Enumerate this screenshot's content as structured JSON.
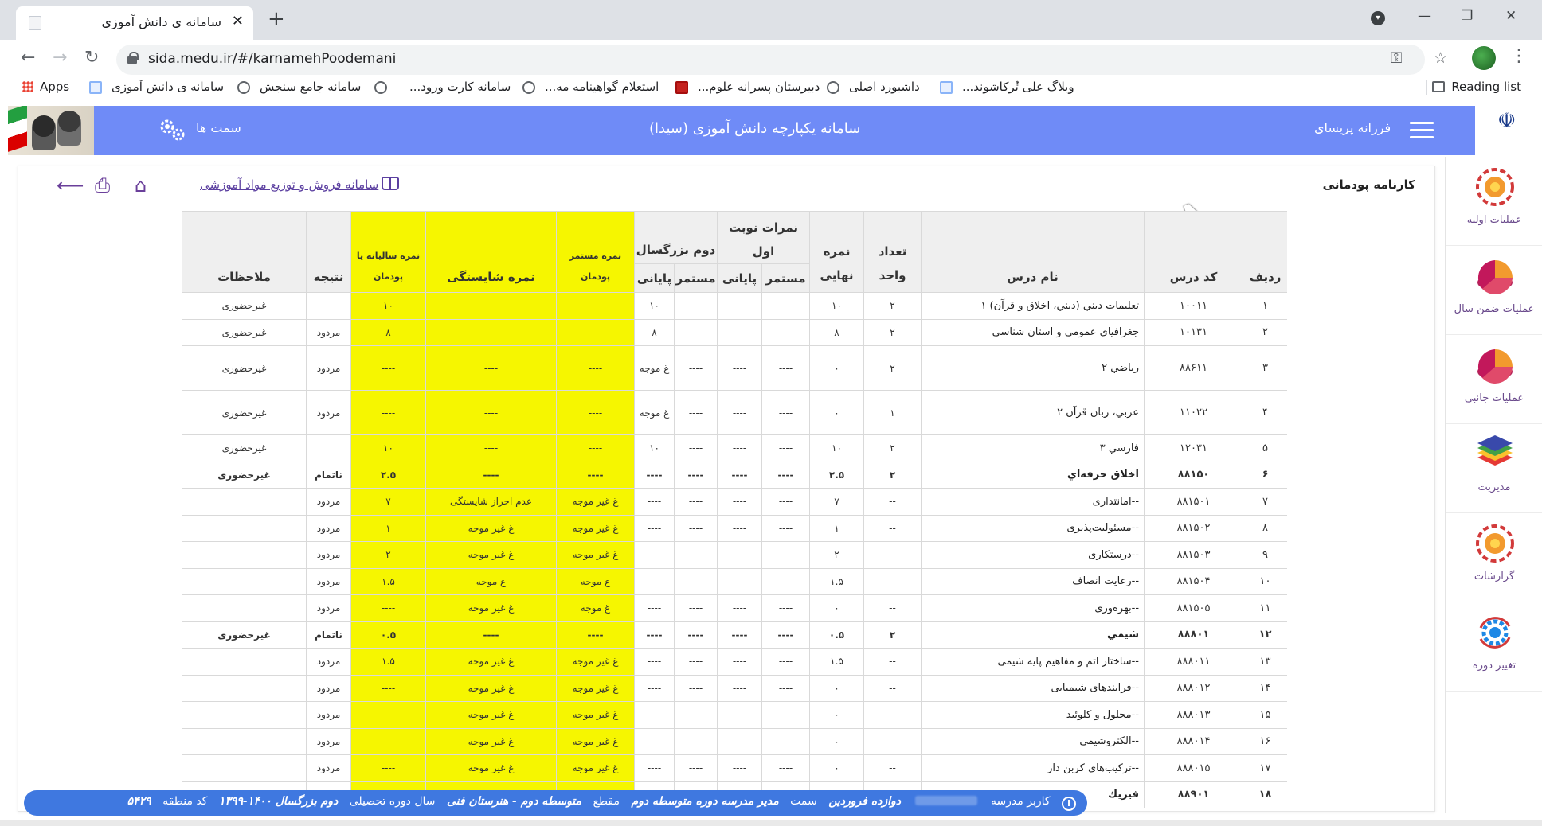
{
  "browser": {
    "tab_title": "سامانه ی دانش آموزی",
    "url": "sida.medu.ir/#/karnamehPoodemani",
    "bookmarks": [
      "Apps",
      "سامانه ی دانش آموزی",
      "سامانه جامع سنجش",
      "سامانه کارت ورود...",
      "استعلام گواهینامه مه...",
      "دبیرستان پسرانه علوم...",
      "داشبورد اصلی",
      "وبلاگ علی تُرکاشوند..."
    ],
    "reading_list": "Reading list"
  },
  "header": {
    "role_label": "سمت ها",
    "title": "سامانه یکپارچه دانش آموزی  (سیدا)",
    "user": "فرزانه پریسای"
  },
  "sidebar": {
    "items": [
      {
        "label": "عملیات اولیه",
        "icon": "gear-sun-icon"
      },
      {
        "label": "عملیات ضمن سال",
        "icon": "pie-chart-icon"
      },
      {
        "label": "عملیات جانبی",
        "icon": "pie-chart-icon"
      },
      {
        "label": "مدیریت",
        "icon": "layers-icon"
      },
      {
        "label": "گزارشات",
        "icon": "gear-sun-icon"
      },
      {
        "label": "تغییر دوره",
        "icon": "gear-cycle-icon"
      }
    ]
  },
  "page": {
    "title": "کارنامه پودمانی",
    "shop_link": "سامانه فروش و توزیع مواد آموزشی"
  },
  "table": {
    "headers": {
      "row": "ردیف",
      "code": "کد درس",
      "name": "نام درس",
      "units": "تعداد واحد",
      "final_grade": "نمره نهایی",
      "first_turn": "نمرات نوبت اول",
      "second_turn": "دوم بزرگسال",
      "continuous": "مستمر",
      "final": "پایانی",
      "mod_continuous": "نمره مستمر پودمان",
      "competency": "نمره شایستگی",
      "yearly": "نمره سالیانه یا پودمان",
      "result": "نتیجه",
      "notes": "ملاحظات"
    },
    "rows": [
      {
        "row": "۱",
        "code": "۱۰۰۱۱",
        "name": "تعليمات ديني (ديني، اخلاق و قرآن) ۱",
        "units": "۲",
        "final": "۱۰",
        "t1c": "----",
        "t1f": "----",
        "t2c": "----",
        "t2f": "۱۰",
        "mc": "----",
        "comp": "----",
        "yearly": "۱۰",
        "result": "",
        "notes": "غیرحضوری",
        "bold": false,
        "tall": false
      },
      {
        "row": "۲",
        "code": "۱۰۱۳۱",
        "name": "جغرافياي عمومي و استان شناسي",
        "units": "۲",
        "final": "۸",
        "t1c": "----",
        "t1f": "----",
        "t2c": "----",
        "t2f": "۸",
        "mc": "----",
        "comp": "----",
        "yearly": "۸",
        "result": "مردود",
        "notes": "غیرحضوری",
        "bold": false,
        "tall": false
      },
      {
        "row": "۳",
        "code": "۸۸۶۱۱",
        "name": "رياضي ۲",
        "units": "۲",
        "final": "۰",
        "t1c": "----",
        "t1f": "----",
        "t2c": "----",
        "t2f": "غ موجه",
        "mc": "----",
        "comp": "----",
        "yearly": "----",
        "result": "مردود",
        "notes": "غیرحضوری",
        "bold": false,
        "tall": true
      },
      {
        "row": "۴",
        "code": "۱۱۰۲۲",
        "name": "عربي، زبان قرآن ۲",
        "units": "۱",
        "final": "۰",
        "t1c": "----",
        "t1f": "----",
        "t2c": "----",
        "t2f": "غ موجه",
        "mc": "----",
        "comp": "----",
        "yearly": "----",
        "result": "مردود",
        "notes": "غیرحضوری",
        "bold": false,
        "tall": true
      },
      {
        "row": "۵",
        "code": "۱۲۰۳۱",
        "name": "فارسي ۳",
        "units": "۲",
        "final": "۱۰",
        "t1c": "----",
        "t1f": "----",
        "t2c": "----",
        "t2f": "۱۰",
        "mc": "----",
        "comp": "----",
        "yearly": "۱۰",
        "result": "",
        "notes": "غیرحضوری",
        "bold": false,
        "tall": false
      },
      {
        "row": "۶",
        "code": "۸۸۱۵۰",
        "name": "اخلاق حرفه‌اي",
        "units": "۲",
        "final": "۲.۵",
        "t1c": "----",
        "t1f": "----",
        "t2c": "----",
        "t2f": "----",
        "mc": "----",
        "comp": "----",
        "yearly": "۲.۵",
        "result": "ناتمام",
        "notes": "غیرحضوری",
        "bold": true,
        "tall": false
      },
      {
        "row": "۷",
        "code": "۸۸۱۵۰۱",
        "name": "--امانتداری",
        "units": "--",
        "final": "۷",
        "t1c": "----",
        "t1f": "----",
        "t2c": "----",
        "t2f": "----",
        "mc": "غ غیر موجه",
        "comp": "عدم احراز شایستگی",
        "yearly": "۷",
        "result": "مردود",
        "notes": "",
        "bold": false,
        "tall": false
      },
      {
        "row": "۸",
        "code": "۸۸۱۵۰۲",
        "name": "--مسئولیت‌پذیری",
        "units": "--",
        "final": "۱",
        "t1c": "----",
        "t1f": "----",
        "t2c": "----",
        "t2f": "----",
        "mc": "غ غیر موجه",
        "comp": "غ غیر موجه",
        "yearly": "۱",
        "result": "مردود",
        "notes": "",
        "bold": false,
        "tall": false
      },
      {
        "row": "۹",
        "code": "۸۸۱۵۰۳",
        "name": "--درستکاری",
        "units": "--",
        "final": "۲",
        "t1c": "----",
        "t1f": "----",
        "t2c": "----",
        "t2f": "----",
        "mc": "غ غیر موجه",
        "comp": "غ غیر موجه",
        "yearly": "۲",
        "result": "مردود",
        "notes": "",
        "bold": false,
        "tall": false
      },
      {
        "row": "۱۰",
        "code": "۸۸۱۵۰۴",
        "name": "--رعایت انصاف",
        "units": "--",
        "final": "۱.۵",
        "t1c": "----",
        "t1f": "----",
        "t2c": "----",
        "t2f": "----",
        "mc": "غ موجه",
        "comp": "غ موجه",
        "yearly": "۱.۵",
        "result": "مردود",
        "notes": "",
        "bold": false,
        "tall": false
      },
      {
        "row": "۱۱",
        "code": "۸۸۱۵۰۵",
        "name": "--بهره‌وری",
        "units": "--",
        "final": "۰",
        "t1c": "----",
        "t1f": "----",
        "t2c": "----",
        "t2f": "----",
        "mc": "غ موجه",
        "comp": "غ غیر موجه",
        "yearly": "----",
        "result": "مردود",
        "notes": "",
        "bold": false,
        "tall": false
      },
      {
        "row": "۱۲",
        "code": "۸۸۸۰۱",
        "name": "شيمي",
        "units": "۲",
        "final": "۰.۵",
        "t1c": "----",
        "t1f": "----",
        "t2c": "----",
        "t2f": "----",
        "mc": "----",
        "comp": "----",
        "yearly": "۰.۵",
        "result": "ناتمام",
        "notes": "غیرحضوری",
        "bold": true,
        "tall": false
      },
      {
        "row": "۱۳",
        "code": "۸۸۸۰۱۱",
        "name": "--ساختار اتم و مفاهیم پایه شیمی",
        "units": "--",
        "final": "۱.۵",
        "t1c": "----",
        "t1f": "----",
        "t2c": "----",
        "t2f": "----",
        "mc": "غ غیر موجه",
        "comp": "غ غیر موجه",
        "yearly": "۱.۵",
        "result": "مردود",
        "notes": "",
        "bold": false,
        "tall": false
      },
      {
        "row": "۱۴",
        "code": "۸۸۸۰۱۲",
        "name": "--فرایندهای شیمیایی",
        "units": "--",
        "final": "۰",
        "t1c": "----",
        "t1f": "----",
        "t2c": "----",
        "t2f": "----",
        "mc": "غ غیر موجه",
        "comp": "غ غیر موجه",
        "yearly": "----",
        "result": "مردود",
        "notes": "",
        "bold": false,
        "tall": false
      },
      {
        "row": "۱۵",
        "code": "۸۸۸۰۱۳",
        "name": "--محلول و کلوئید",
        "units": "--",
        "final": "۰",
        "t1c": "----",
        "t1f": "----",
        "t2c": "----",
        "t2f": "----",
        "mc": "غ غیر موجه",
        "comp": "غ غیر موجه",
        "yearly": "----",
        "result": "مردود",
        "notes": "",
        "bold": false,
        "tall": false
      },
      {
        "row": "۱۶",
        "code": "۸۸۸۰۱۴",
        "name": "--الکتروشیمی",
        "units": "--",
        "final": "۰",
        "t1c": "----",
        "t1f": "----",
        "t2c": "----",
        "t2f": "----",
        "mc": "غ غیر موجه",
        "comp": "غ غیر موجه",
        "yearly": "----",
        "result": "مردود",
        "notes": "",
        "bold": false,
        "tall": false
      },
      {
        "row": "۱۷",
        "code": "۸۸۸۰۱۵",
        "name": "--ترکیب‌های کربن دار",
        "units": "--",
        "final": "۰",
        "t1c": "----",
        "t1f": "----",
        "t2c": "----",
        "t2f": "----",
        "mc": "غ غیر موجه",
        "comp": "غ غیر موجه",
        "yearly": "----",
        "result": "مردود",
        "notes": "",
        "bold": false,
        "tall": false
      },
      {
        "row": "۱۸",
        "code": "۸۸۹۰۱",
        "name": "فيزيك",
        "units": "",
        "final": "",
        "t1c": "",
        "t1f": "",
        "t2c": "",
        "t2f": "",
        "mc": "",
        "comp": "",
        "yearly": "",
        "result": "",
        "notes": "",
        "bold": true,
        "tall": false
      }
    ]
  },
  "status": {
    "user_label": "کاربر مدرسه",
    "school": "دوازده فروردین",
    "role_label": "سمت",
    "role": "مدیر مدرسه دوره متوسطه دوم",
    "level_label": "مقطع",
    "level": "متوسطه دوم - هنرستان فنی",
    "period_label": "سال دوره تحصیلی",
    "period": "دوم بزرگسال ۱۴۰۰-۱۳۹۹",
    "region_label": "کد منطقه",
    "region": "۵۴۲۹"
  },
  "colors": {
    "appbar": "#6f8bf7",
    "highlight": "#f6f600",
    "statusbar": "#3f78e0",
    "accent": "#6a3f9a"
  }
}
